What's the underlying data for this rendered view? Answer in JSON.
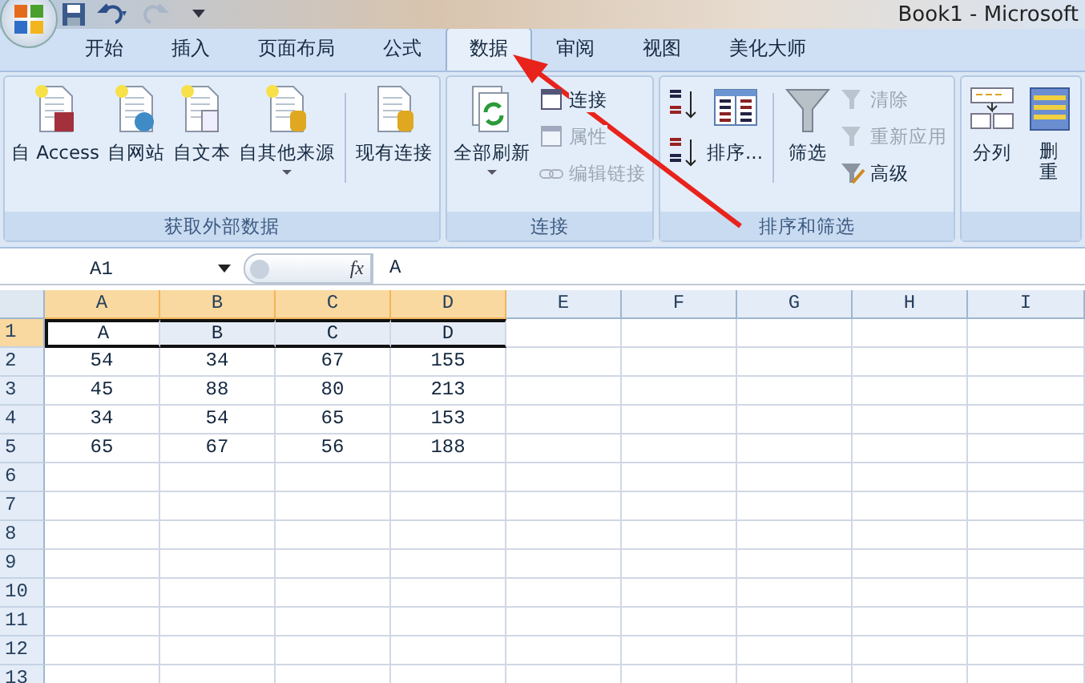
{
  "title_bar": {
    "title": "Book1 - Microsoft"
  },
  "tabs": [
    {
      "label": "开始",
      "selected": false
    },
    {
      "label": "插入",
      "selected": false
    },
    {
      "label": "页面布局",
      "selected": false
    },
    {
      "label": "公式",
      "selected": false
    },
    {
      "label": "数据",
      "selected": true
    },
    {
      "label": "审阅",
      "selected": false
    },
    {
      "label": "视图",
      "selected": false
    },
    {
      "label": "美化大师",
      "selected": false
    }
  ],
  "ribbon": {
    "groups": [
      {
        "label": "获取外部数据",
        "buttons": [
          {
            "kind": "large",
            "label": "自 Access",
            "dropdown": false
          },
          {
            "kind": "large",
            "label": "自网站",
            "dropdown": false
          },
          {
            "kind": "large",
            "label": "自文本",
            "dropdown": false
          },
          {
            "kind": "large",
            "label": "自其他来源",
            "dropdown": true
          },
          {
            "kind": "separator"
          },
          {
            "kind": "large",
            "label": "现有连接",
            "dropdown": false
          }
        ]
      },
      {
        "label": "连接",
        "buttons": [
          {
            "kind": "large",
            "label": "全部刷新",
            "dropdown": true
          },
          {
            "kind": "stack",
            "items": [
              {
                "label": "连接",
                "disabled": false
              },
              {
                "label": "属性",
                "disabled": true
              },
              {
                "label": "编辑链接",
                "disabled": true
              }
            ]
          }
        ]
      },
      {
        "label": "排序和筛选",
        "buttons": [
          {
            "kind": "sortpair"
          },
          {
            "kind": "large",
            "label": "排序...",
            "dropdown": false
          },
          {
            "kind": "separator"
          },
          {
            "kind": "large",
            "label": "筛选",
            "dropdown": false
          },
          {
            "kind": "stack",
            "items": [
              {
                "label": "清除",
                "disabled": true
              },
              {
                "label": "重新应用",
                "disabled": true
              },
              {
                "label": "高级",
                "disabled": false
              }
            ]
          }
        ]
      },
      {
        "buttons": [
          {
            "kind": "large",
            "label": "分列",
            "dropdown": false
          },
          {
            "kind": "large",
            "label": "删重",
            "dropdown": false
          }
        ]
      }
    ]
  },
  "formula_bar": {
    "name_box": "A1",
    "fx": "fx",
    "content": "A"
  },
  "sheet": {
    "columns": [
      {
        "label": "A",
        "selected": true
      },
      {
        "label": "B",
        "selected": true
      },
      {
        "label": "C",
        "selected": true
      },
      {
        "label": "D",
        "selected": true
      },
      {
        "label": "E",
        "selected": false
      },
      {
        "label": "F",
        "selected": false
      },
      {
        "label": "G",
        "selected": false
      },
      {
        "label": "H",
        "selected": false
      },
      {
        "label": "I",
        "selected": false
      }
    ],
    "rows": [
      {
        "label": "1",
        "selected": true,
        "cells": [
          "A",
          "B",
          "C",
          "D"
        ]
      },
      {
        "label": "2",
        "selected": false,
        "cells": [
          "54",
          "34",
          "67",
          "155"
        ]
      },
      {
        "label": "3",
        "selected": false,
        "cells": [
          "45",
          "88",
          "80",
          "213"
        ]
      },
      {
        "label": "4",
        "selected": false,
        "cells": [
          "34",
          "54",
          "65",
          "153"
        ]
      },
      {
        "label": "5",
        "selected": false,
        "cells": [
          "65",
          "67",
          "56",
          "188"
        ]
      },
      {
        "label": "6",
        "selected": false,
        "cells": []
      },
      {
        "label": "7",
        "selected": false,
        "cells": []
      },
      {
        "label": "8",
        "selected": false,
        "cells": []
      },
      {
        "label": "9",
        "selected": false,
        "cells": []
      },
      {
        "label": "10",
        "selected": false,
        "cells": []
      },
      {
        "label": "11",
        "selected": false,
        "cells": []
      },
      {
        "label": "12",
        "selected": false,
        "cells": []
      },
      {
        "label": "13",
        "selected": false,
        "cells": []
      }
    ]
  }
}
